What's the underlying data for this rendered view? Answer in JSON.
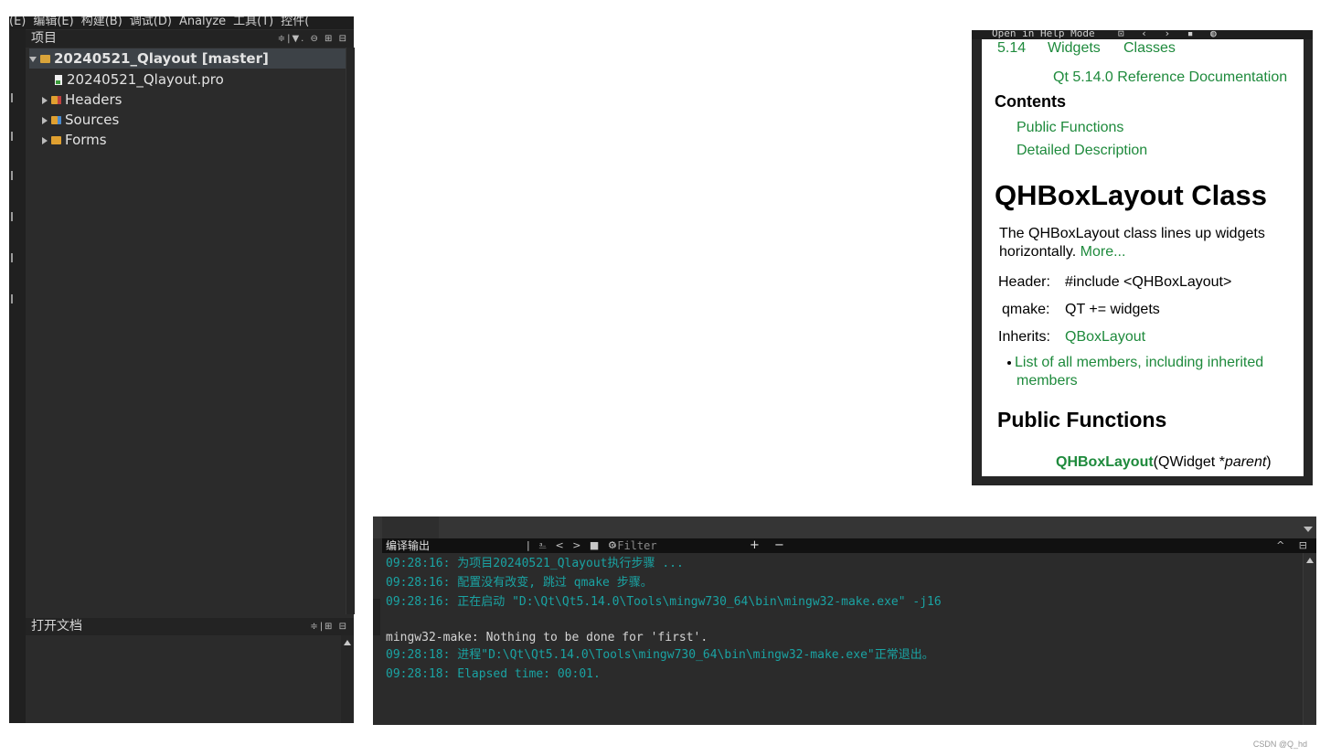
{
  "menu_bar": {
    "items": [
      "(E)",
      "编辑(E)",
      "构建(B)",
      "调试(D)",
      "Analyze",
      "工具(T)",
      "控件("
    ]
  },
  "project_panel": {
    "header": "项目",
    "tools_glyphs": "≑|▼. ⊖ ⊞ ⊟",
    "tree": {
      "root": "20240521_Qlayout [master]",
      "file": "20240521_Qlayout.pro",
      "folders": [
        "Headers",
        "Sources",
        "Forms"
      ]
    },
    "open_docs_header": "打开文档",
    "open_docs_tools": "≑|⊞ ⊟"
  },
  "output_panel": {
    "label": "编译输出",
    "tools_glyphs": "| ⎁ < > ■ ⚙",
    "filter_placeholder": "Filter",
    "plus_minus": "+ −",
    "right_glyphs": "^ ⊟",
    "lines": [
      {
        "text": "09:28:16: 为项目20240521_Qlayout执行步骤 ...",
        "style": "teal"
      },
      {
        "text": "09:28:16: 配置没有改变, 跳过 qmake 步骤。",
        "style": "teal"
      },
      {
        "text": "09:28:16: 正在启动 \"D:\\Qt\\Qt5.14.0\\Tools\\mingw730_64\\bin\\mingw32-make.exe\" -j16",
        "style": "teal"
      },
      {
        "text": "",
        "style": "white"
      },
      {
        "text": "mingw32-make: Nothing to be done for 'first'.",
        "style": "white"
      },
      {
        "text": "09:28:18: 进程\"D:\\Qt\\Qt5.14.0\\Tools\\mingw730_64\\bin\\mingw32-make.exe\"正常退出。",
        "style": "teal"
      },
      {
        "text": "09:28:18: Elapsed time: 00:01.",
        "style": "teal"
      }
    ]
  },
  "help_panel": {
    "toolbar_text": "Open in Help Mode",
    "breadcrumbs": [
      "5.14",
      "Widgets",
      "Classes"
    ],
    "ref_doc": "Qt 5.14.0 Reference Documentation",
    "contents_heading": "Contents",
    "contents_links": [
      "Public Functions",
      "Detailed Description"
    ],
    "class_title": "QHBoxLayout Class",
    "description_1": "The QHBoxLayout class lines up widgets",
    "description_2": "horizontally.",
    "more_link": "More...",
    "header_label": "Header:",
    "header_value": "#include <QHBoxLayout>",
    "qmake_label": "qmake:",
    "qmake_value": "QT += widgets",
    "inherits_label": "Inherits:",
    "inherits_value": "QBoxLayout",
    "members_link_1": "List of all members, including inherited",
    "members_link_2": "members",
    "public_functions_heading": "Public Functions",
    "function_name": "QHBoxLayout",
    "function_args_pre": "(QWidget *",
    "function_args_param": "parent",
    "function_args_post": ")"
  },
  "watermark": "CSDN @Q_hd",
  "colors": {
    "ide_bg": "#2b2b2b",
    "output_teal": "#1aa3a3",
    "help_link": "#1e8a3c"
  }
}
